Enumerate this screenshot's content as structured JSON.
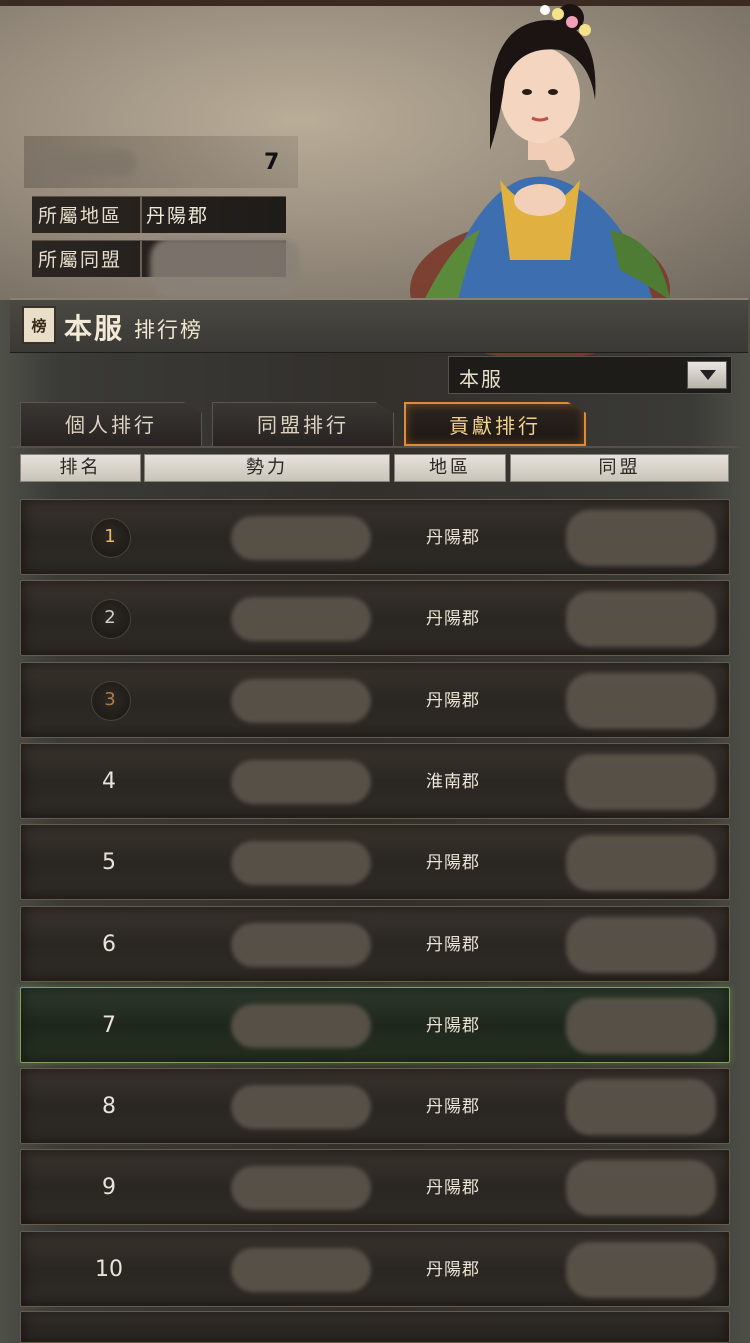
{
  "profile": {
    "level": "7",
    "region_label": "所屬地區",
    "region_value": "丹陽郡",
    "alliance_label": "所屬同盟"
  },
  "panel": {
    "badge": "榜",
    "title": "本服",
    "subtitle": "排行榜",
    "dropdown_value": "本服"
  },
  "tabs": [
    {
      "label": "個人排行",
      "active": false
    },
    {
      "label": "同盟排行",
      "active": false
    },
    {
      "label": "貢獻排行",
      "active": true
    }
  ],
  "columns": [
    "排名",
    "勢力",
    "地區",
    "同盟"
  ],
  "rows": [
    {
      "rank": "1",
      "region": "丹陽郡",
      "highlight": false
    },
    {
      "rank": "2",
      "region": "丹陽郡",
      "highlight": false
    },
    {
      "rank": "3",
      "region": "丹陽郡",
      "highlight": false
    },
    {
      "rank": "4",
      "region": "淮南郡",
      "highlight": false
    },
    {
      "rank": "5",
      "region": "丹陽郡",
      "highlight": false
    },
    {
      "rank": "6",
      "region": "丹陽郡",
      "highlight": false
    },
    {
      "rank": "7",
      "region": "丹陽郡",
      "highlight": true
    },
    {
      "rank": "8",
      "region": "丹陽郡",
      "highlight": false
    },
    {
      "rank": "9",
      "region": "丹陽郡",
      "highlight": false
    },
    {
      "rank": "10",
      "region": "丹陽郡",
      "highlight": false
    }
  ],
  "colors": {
    "active_tab_border": "#e08a3c",
    "highlight_row_border": "#7ea060",
    "gold": "#e9b96a",
    "silver": "#cfcfcf",
    "bronze": "#b07a48"
  }
}
